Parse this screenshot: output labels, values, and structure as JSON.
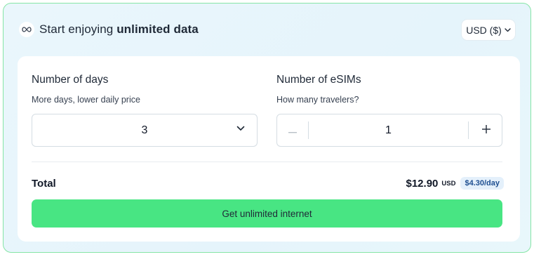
{
  "header": {
    "title_prefix": "Start enjoying ",
    "title_emphasis": "unlimited data",
    "icon": "infinity-icon"
  },
  "currency_select": {
    "value": "USD ($)",
    "icon": "chevron-down-icon"
  },
  "days": {
    "title": "Number of days",
    "subtitle": "More days, lower daily price",
    "value": "3"
  },
  "esims": {
    "title": "Number of eSIMs",
    "subtitle": "How many travelers?",
    "value": "1",
    "minus_icon": "minus-icon",
    "plus_icon": "plus-icon"
  },
  "total": {
    "label": "Total",
    "price": "$12.90",
    "currency": "USD",
    "per_day": "$4.30/day"
  },
  "cta": {
    "label": "Get unlimited internet"
  },
  "colors": {
    "accent_green": "#48e583",
    "border_green": "#86e5a6",
    "badge_bg": "#e4f0fb",
    "badge_text": "#1e4f91"
  }
}
